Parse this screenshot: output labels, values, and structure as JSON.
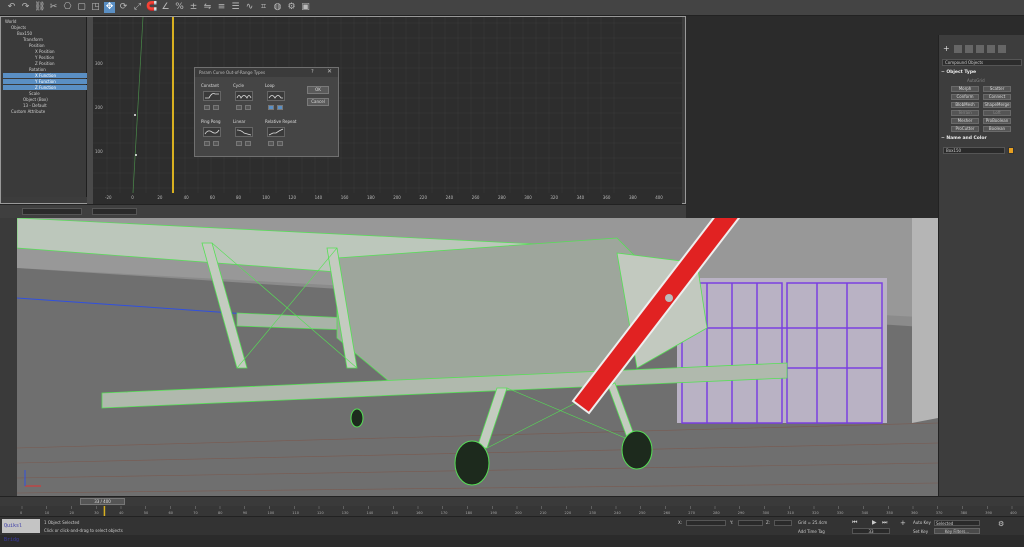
{
  "top_toolbar": {
    "tools": [
      "undo-icon",
      "redo-icon",
      "link-icon",
      "unlink-icon",
      "bind-icon",
      "select-icon",
      "region-icon",
      "move-icon",
      "rotate-icon",
      "scale-icon",
      "snap-icon",
      "angle-snap-icon",
      "percent-snap-icon",
      "spinner-snap-icon",
      "mirror-icon",
      "align-icon",
      "layer-icon",
      "curve-icon",
      "schematic-icon",
      "material-icon",
      "render-setup-icon",
      "render-icon"
    ]
  },
  "curve_editor": {
    "tree": [
      {
        "label": "World",
        "indent": 0,
        "selected": false
      },
      {
        "label": "Objects",
        "indent": 1,
        "selected": false
      },
      {
        "label": "Box150",
        "indent": 2,
        "selected": false
      },
      {
        "label": "Transform",
        "indent": 3,
        "selected": false
      },
      {
        "label": "Position",
        "indent": 4,
        "selected": false
      },
      {
        "label": "X Position",
        "indent": 5,
        "selected": false
      },
      {
        "label": "Y Position",
        "indent": 5,
        "selected": false
      },
      {
        "label": "Z Position",
        "indent": 5,
        "selected": false
      },
      {
        "label": "Rotation",
        "indent": 4,
        "selected": false
      },
      {
        "label": "X Function",
        "indent": 5,
        "selected": true
      },
      {
        "label": "Y Function",
        "indent": 5,
        "selected": true
      },
      {
        "label": "Z Function",
        "indent": 5,
        "selected": true
      },
      {
        "label": "Scale",
        "indent": 4,
        "selected": false
      },
      {
        "label": "Object (Box)",
        "indent": 3,
        "selected": false
      },
      {
        "label": "13 - Default",
        "indent": 3,
        "selected": false
      },
      {
        "label": "Custom Attribute",
        "indent": 1,
        "selected": false
      }
    ],
    "y_ticks": [
      "300",
      "200",
      "100"
    ],
    "x_ticks": [
      "-20",
      "0",
      "20",
      "40",
      "60",
      "80",
      "100",
      "120",
      "140",
      "160",
      "180",
      "200",
      "220",
      "240",
      "260",
      "280",
      "300",
      "320",
      "340",
      "360",
      "380",
      "400"
    ]
  },
  "dialog": {
    "title": "Param Curve Out-of-Range Types",
    "constant": "Constant",
    "cycle": "Cycle",
    "loop": "Loop",
    "ping_pong": "Ping Pong",
    "linear": "Linear",
    "relative_repeat": "Relative Repeat",
    "ok": "OK",
    "cancel": "Cancel"
  },
  "command_panel": {
    "dropdown": "Compound Objects",
    "object_type_title": "Object Type",
    "autogrid": "AutoGrid",
    "buttons": [
      {
        "label": "Morph",
        "dim": false
      },
      {
        "label": "Scatter",
        "dim": false
      },
      {
        "label": "Conform",
        "dim": false
      },
      {
        "label": "Connect",
        "dim": false
      },
      {
        "label": "BlobMesh",
        "dim": false
      },
      {
        "label": "ShapeMerge",
        "dim": false
      },
      {
        "label": "Terrain",
        "dim": true
      },
      {
        "label": "Loft",
        "dim": true
      },
      {
        "label": "Mesher",
        "dim": false
      },
      {
        "label": "ProBoolean",
        "dim": false
      },
      {
        "label": "ProCutter",
        "dim": false
      },
      {
        "label": "Boolean",
        "dim": false
      }
    ],
    "name_color_title": "Name and Color",
    "name_value": "Box150",
    "swatch_color": "#e8a020"
  },
  "timeline": {
    "frame_display": "33 / 400",
    "ruler_ticks": [
      "0",
      "10",
      "20",
      "30",
      "40",
      "50",
      "60",
      "70",
      "80",
      "90",
      "100",
      "110",
      "120",
      "130",
      "140",
      "150",
      "160",
      "170",
      "180",
      "190",
      "200",
      "210",
      "220",
      "230",
      "240",
      "250",
      "260",
      "270",
      "280",
      "290",
      "300",
      "310",
      "320",
      "330",
      "340",
      "350",
      "360",
      "370",
      "380",
      "390",
      "400"
    ]
  },
  "status_bar": {
    "maxscript": "Quiksl Bridg",
    "selected": "1 Object Selected",
    "hint": "Click or click-and-drag to select objects",
    "x_label": "X:",
    "y_label": "Y:",
    "z_label": "Z:",
    "grid": "Grid = 25.4cm",
    "add_time_tag": "Add Time Tag",
    "auto_key": "Auto Key",
    "set_key": "Set Key",
    "selected_dropdown": "Selected",
    "key_filters": "Key Filters...",
    "frame_value": "33"
  },
  "colors": {
    "accent": "#5a8fc4",
    "wire_green": "#55e055",
    "prop_red": "#e12222",
    "purple": "#7a3fe0"
  }
}
